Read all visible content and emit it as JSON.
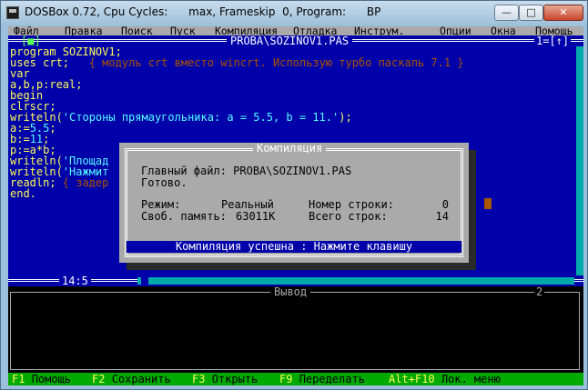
{
  "window": {
    "title": "DOSBox 0.72, Cpu Cycles:      max, Frameskip  0, Program:      BP",
    "buttons": {
      "minimize": "—",
      "maximize": "□",
      "close": "✕"
    }
  },
  "menu": {
    "items": [
      {
        "label": "Файл"
      },
      {
        "label": "Правка"
      },
      {
        "label": "Поиск"
      },
      {
        "label": "Пуск"
      },
      {
        "label": "Компиляция"
      },
      {
        "label": "Отладка"
      },
      {
        "label": "Инструм."
      },
      {
        "label": "Опции"
      },
      {
        "label": "Окна"
      },
      {
        "label": "Помощь"
      }
    ]
  },
  "editor": {
    "close_marker": "[■]",
    "title": "PROBA\\SOZINOV1.PAS",
    "window_number": "1=[↑]",
    "cursor_position": "14:5",
    "code": [
      {
        "segments": [
          {
            "t": "program SOZINOV1;",
            "c": "kw"
          }
        ]
      },
      {
        "segments": [
          {
            "t": "uses crt;   ",
            "c": "kw"
          },
          {
            "t": "{ модуль crt вместо wincrt. Использую турбо паскаль 7.1 }",
            "c": "cmt"
          }
        ]
      },
      {
        "segments": [
          {
            "t": "var",
            "c": "kw"
          }
        ]
      },
      {
        "segments": [
          {
            "t": "a,b,p:real;",
            "c": "kw"
          }
        ]
      },
      {
        "segments": [
          {
            "t": "begin",
            "c": "kw"
          }
        ]
      },
      {
        "segments": [
          {
            "t": "clrscr;",
            "c": "kw"
          }
        ]
      },
      {
        "segments": [
          {
            "t": "writeln(",
            "c": "kw"
          },
          {
            "t": "'Стороны прямаугольника: a = 5.5, b = 11.'",
            "c": "str"
          },
          {
            "t": ");",
            "c": "kw"
          }
        ]
      },
      {
        "segments": [
          {
            "t": "a:=",
            "c": "kw"
          },
          {
            "t": "5.5",
            "c": "str"
          },
          {
            "t": ";",
            "c": "kw"
          }
        ]
      },
      {
        "segments": [
          {
            "t": "b:=",
            "c": "kw"
          },
          {
            "t": "11",
            "c": "str"
          },
          {
            "t": ";",
            "c": "kw"
          }
        ]
      },
      {
        "segments": [
          {
            "t": "p:=a*b;",
            "c": "kw"
          }
        ]
      },
      {
        "segments": [
          {
            "t": "writeln(",
            "c": "kw"
          },
          {
            "t": "'Площад",
            "c": "str"
          }
        ]
      },
      {
        "segments": [
          {
            "t": "writeln(",
            "c": "kw"
          },
          {
            "t": "'Нажмит",
            "c": "str"
          }
        ]
      },
      {
        "segments": [
          {
            "t": "readln; ",
            "c": "kw"
          },
          {
            "t": "{ задер",
            "c": "cmt"
          }
        ]
      },
      {
        "segments": [
          {
            "t": "end.",
            "c": "kw"
          }
        ]
      }
    ]
  },
  "output": {
    "title": "Вывод",
    "window_number": "2"
  },
  "dialog": {
    "title": "Компиляция",
    "main_file_label": "Главный файл:",
    "main_file_value": "PROBA\\SOZINOV1.PAS",
    "state": "Готово.",
    "mode_label": "Режим:",
    "mode_value": "Реальный",
    "line_no_label": "Номер строки:",
    "line_no_value": "0",
    "free_mem_label": "Своб. память:",
    "free_mem_value": "63011К",
    "total_lines_label": "Всего строк:",
    "total_lines_value": "14",
    "status": "Компиляция успешна : Нажмите клавишу"
  },
  "statusbar": {
    "items": [
      {
        "key": "F1",
        "label": "Помощь"
      },
      {
        "key": "F2",
        "label": "Сохранить"
      },
      {
        "key": "F3",
        "label": "Открыть"
      },
      {
        "key": "F9",
        "label": "Переделать"
      },
      {
        "key": "Alt+F10",
        "label": "Лок. меню"
      }
    ]
  },
  "colors": {
    "editor_bg": "#0000aa",
    "menu_bg": "#aaaaaa",
    "status_bg": "#00aa00",
    "comment": "#aa5500",
    "string": "#55ffff"
  }
}
